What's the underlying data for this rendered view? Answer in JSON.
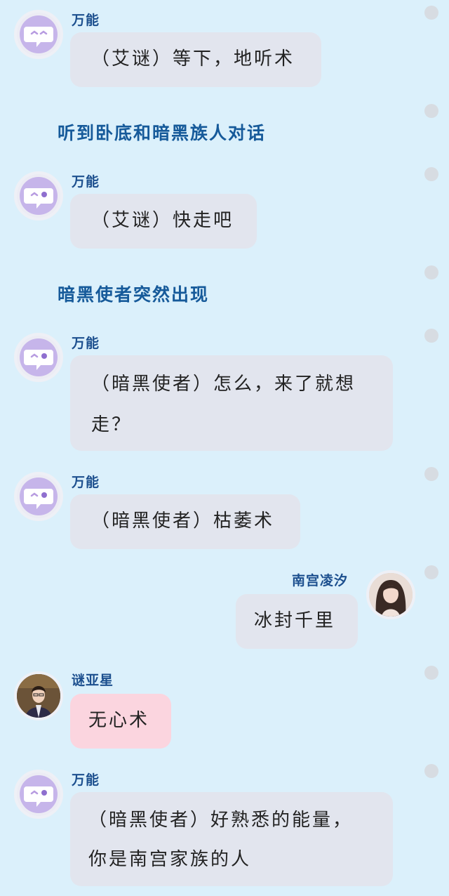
{
  "messages": [
    {
      "sender": "万能",
      "text": "（艾谜）等下，地听术"
    },
    {
      "narration": "听到卧底和暗黑族人对话"
    },
    {
      "sender": "万能",
      "text": "（艾谜）快走吧"
    },
    {
      "narration": "暗黑使者突然出现"
    },
    {
      "sender": "万能",
      "text_line1": "（暗黑使者）怎么，来了就想",
      "text_line2": "走？"
    },
    {
      "sender": "万能",
      "text": "（暗黑使者）枯萎术"
    },
    {
      "sender": "南宫凌汐",
      "text": "冰封千里"
    },
    {
      "sender": "谜亚星",
      "text": "无心术"
    },
    {
      "sender": "万能",
      "text_line1": "（暗黑使者）好熟悉的能量，",
      "text_line2": "你是南宫家族的人"
    }
  ],
  "icons": {
    "bot_avatar": "chat-bubble-face-icon",
    "options_dot": "circle-dot-icon"
  },
  "colors": {
    "background": "#dbf0fb",
    "sender_name": "#1c4f8e",
    "narration": "#165a9a",
    "bubble": "#e2e5ee",
    "bubble_pink": "#fbd5df"
  }
}
